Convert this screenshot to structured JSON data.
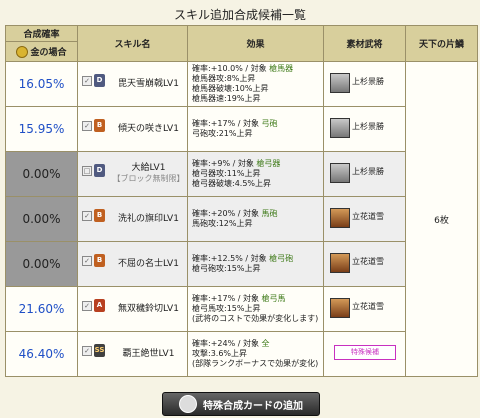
{
  "page": {
    "title": "スキル追加合成候補一覧"
  },
  "headers": {
    "rate": "合成確率",
    "rate_sub": "金の場合",
    "skill": "スキル名",
    "effect": "効果",
    "material": "素材武将",
    "tenka": "天下の片鱗"
  },
  "rows": [
    {
      "rate": "16.05%",
      "rank": "D",
      "name": "毘天雪崩戟LV1",
      "block": "",
      "effect_line1": "確率:+10.0% / 対象",
      "effect_target": "槍馬器",
      "effect_rest1": "槍馬器攻:8%上昇",
      "effect_rest2": "槍馬器破壊:10%上昇",
      "effect_rest3": "槍馬器速:19%上昇",
      "general": "上杉景勝"
    },
    {
      "rate": "15.95%",
      "rank": "B",
      "name": "傾天の咲きLV1",
      "block": "",
      "effect_line1": "確率:+17% / 対象",
      "effect_target": "弓砲",
      "effect_rest1": "弓砲攻:21%上昇",
      "effect_rest2": "",
      "effect_rest3": "",
      "general": "上杉景勝"
    },
    {
      "rate": "0.00%",
      "rank": "D",
      "name": "大給LV1",
      "block": "【ブロック無制限】",
      "effect_line1": "確率:+9% / 対象",
      "effect_target": "槍弓器",
      "effect_rest1": "槍弓器攻:11%上昇",
      "effect_rest2": "槍弓器破壊:4.5%上昇",
      "effect_rest3": "",
      "general": "上杉景勝"
    },
    {
      "rate": "0.00%",
      "rank": "B",
      "name": "洗礼の旗印LV1",
      "block": "",
      "effect_line1": "確率:+20% / 対象",
      "effect_target": "馬砲",
      "effect_rest1": "馬砲攻:12%上昇",
      "effect_rest2": "",
      "effect_rest3": "",
      "general": "立花道雪"
    },
    {
      "rate": "0.00%",
      "rank": "B",
      "name": "不屈の名士LV1",
      "block": "",
      "effect_line1": "確率:+12.5% / 対象",
      "effect_target": "槍弓砲",
      "effect_rest1": "槍弓砲攻:15%上昇",
      "effect_rest2": "",
      "effect_rest3": "",
      "general": "立花道雪"
    },
    {
      "rate": "21.60%",
      "rank": "A",
      "name": "無双穢鈴切LV1",
      "block": "",
      "effect_line1": "確率:+17% / 対象",
      "effect_target": "槍弓馬",
      "effect_rest1": "槍弓馬攻:15%上昇",
      "effect_rest2": "(武将のコストで効果が変化します)",
      "effect_rest3": "",
      "general": "立花道雪"
    },
    {
      "rate": "46.40%",
      "rank": "SS",
      "name": "覇王絶世LV1",
      "block": "",
      "effect_line1": "確率:+24% / 対象",
      "effect_target": "全",
      "effect_rest1": "攻撃:3.6%上昇",
      "effect_rest2": "(部隊ランクボーナスで効果が変化)",
      "effect_rest3": "",
      "general": "特殊候補"
    }
  ],
  "tenka_value": "6枚",
  "add_button": "特殊合成カードの追加"
}
